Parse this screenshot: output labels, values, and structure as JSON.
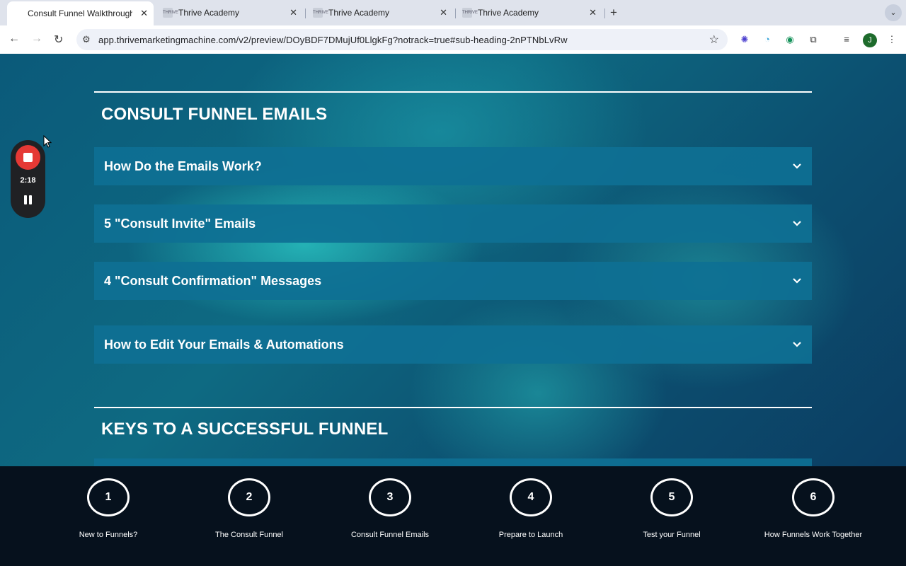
{
  "browser": {
    "tabs": [
      {
        "title": "Consult Funnel Walkthrough",
        "active": true
      },
      {
        "title": "Thrive Academy",
        "active": false
      },
      {
        "title": "Thrive Academy",
        "active": false
      },
      {
        "title": "Thrive Academy",
        "active": false
      }
    ],
    "url": "app.thrivemarketingmachine.com/v2/preview/DOyBDF7DMujUf0LlgkFg?notrack=true#sub-heading-2nPTNbLvRw",
    "profile_initial": "J",
    "favicon_text": "THRIVE"
  },
  "recorder": {
    "elapsed": "2:18"
  },
  "sections": [
    {
      "title": "CONSULT FUNNEL EMAILS",
      "accordions": [
        "How Do the Emails Work?",
        "5 \"Consult Invite\" Emails",
        "4 \"Consult Confirmation\" Messages",
        "How to Edit Your Emails & Automations"
      ]
    },
    {
      "title": "KEYS TO A SUCCESSFUL FUNNEL",
      "accordions": []
    }
  ],
  "steps": [
    {
      "number": "1",
      "label": "New to Funnels?"
    },
    {
      "number": "2",
      "label": "The Consult Funnel"
    },
    {
      "number": "3",
      "label": "Consult Funnel Emails"
    },
    {
      "number": "4",
      "label": "Prepare to Launch"
    },
    {
      "number": "5",
      "label": "Test your Funnel"
    },
    {
      "number": "6",
      "label": "How Funnels Work Together"
    }
  ],
  "colors": {
    "accordion_bg": "#0e7094",
    "step_bar_bg": "#06111d",
    "record_red": "#e53935"
  }
}
